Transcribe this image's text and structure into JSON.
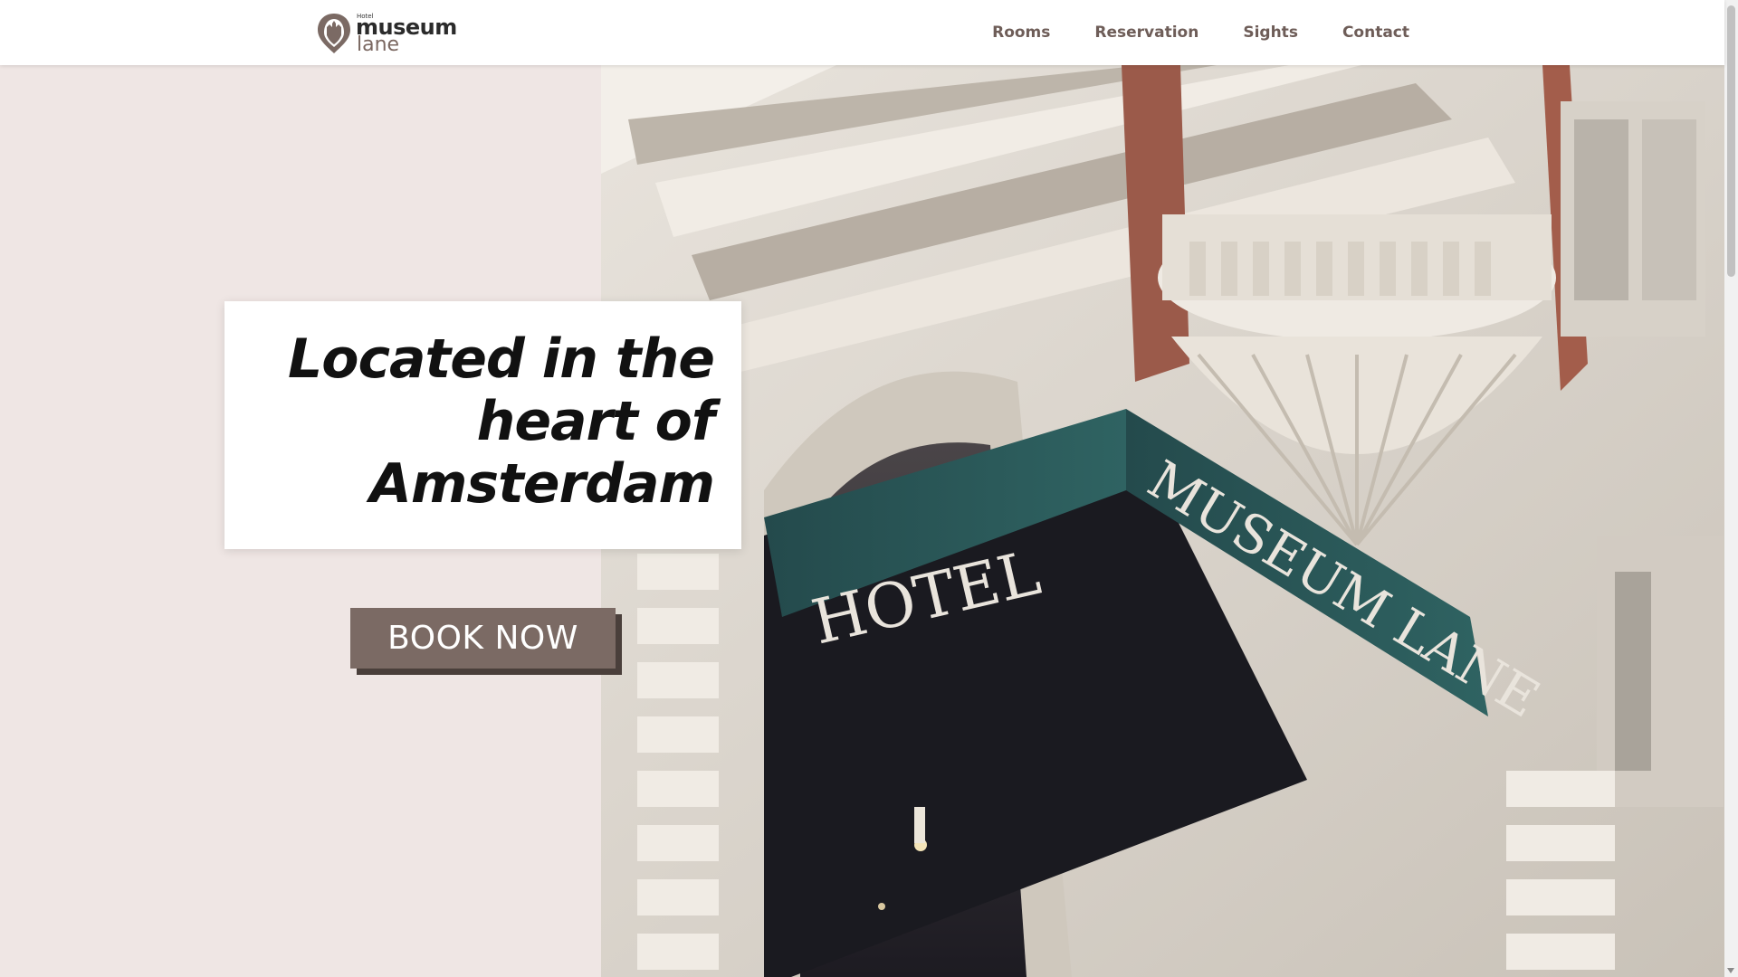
{
  "brand": {
    "small": "Hotel",
    "main": "museum",
    "sub": "lane"
  },
  "nav": {
    "items": [
      {
        "label": "Rooms"
      },
      {
        "label": "Reservation"
      },
      {
        "label": "Sights"
      },
      {
        "label": "Contact"
      }
    ]
  },
  "hero": {
    "headline_lines": [
      "Located in the",
      "heart of",
      "Amsterdam"
    ],
    "cta_label": "BOOK NOW",
    "photo": {
      "sign_left_text": "HOTEL",
      "sign_right_text": "MUSEUM LANE"
    }
  },
  "colors": {
    "accent": "#7b6a64",
    "accent_shadow": "#4a3f3b",
    "panel_background": "#efe6e4",
    "nav_text": "#6e5d58",
    "sign_teal": "#2d5a5a"
  },
  "icons": {
    "logo": "map-pin-icon"
  }
}
